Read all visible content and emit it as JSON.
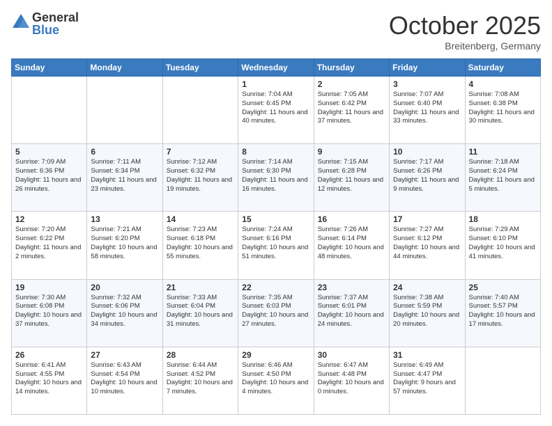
{
  "header": {
    "logo_general": "General",
    "logo_blue": "Blue",
    "month_title": "October 2025",
    "location": "Breitenberg, Germany"
  },
  "weekdays": [
    "Sunday",
    "Monday",
    "Tuesday",
    "Wednesday",
    "Thursday",
    "Friday",
    "Saturday"
  ],
  "weeks": [
    [
      {
        "day": "",
        "info": ""
      },
      {
        "day": "",
        "info": ""
      },
      {
        "day": "",
        "info": ""
      },
      {
        "day": "1",
        "info": "Sunrise: 7:04 AM\nSunset: 6:45 PM\nDaylight: 11 hours and 40 minutes."
      },
      {
        "day": "2",
        "info": "Sunrise: 7:05 AM\nSunset: 6:42 PM\nDaylight: 11 hours and 37 minutes."
      },
      {
        "day": "3",
        "info": "Sunrise: 7:07 AM\nSunset: 6:40 PM\nDaylight: 11 hours and 33 minutes."
      },
      {
        "day": "4",
        "info": "Sunrise: 7:08 AM\nSunset: 6:38 PM\nDaylight: 11 hours and 30 minutes."
      }
    ],
    [
      {
        "day": "5",
        "info": "Sunrise: 7:09 AM\nSunset: 6:36 PM\nDaylight: 11 hours and 26 minutes."
      },
      {
        "day": "6",
        "info": "Sunrise: 7:11 AM\nSunset: 6:34 PM\nDaylight: 11 hours and 23 minutes."
      },
      {
        "day": "7",
        "info": "Sunrise: 7:12 AM\nSunset: 6:32 PM\nDaylight: 11 hours and 19 minutes."
      },
      {
        "day": "8",
        "info": "Sunrise: 7:14 AM\nSunset: 6:30 PM\nDaylight: 11 hours and 16 minutes."
      },
      {
        "day": "9",
        "info": "Sunrise: 7:15 AM\nSunset: 6:28 PM\nDaylight: 11 hours and 12 minutes."
      },
      {
        "day": "10",
        "info": "Sunrise: 7:17 AM\nSunset: 6:26 PM\nDaylight: 11 hours and 9 minutes."
      },
      {
        "day": "11",
        "info": "Sunrise: 7:18 AM\nSunset: 6:24 PM\nDaylight: 11 hours and 5 minutes."
      }
    ],
    [
      {
        "day": "12",
        "info": "Sunrise: 7:20 AM\nSunset: 6:22 PM\nDaylight: 11 hours and 2 minutes."
      },
      {
        "day": "13",
        "info": "Sunrise: 7:21 AM\nSunset: 6:20 PM\nDaylight: 10 hours and 58 minutes."
      },
      {
        "day": "14",
        "info": "Sunrise: 7:23 AM\nSunset: 6:18 PM\nDaylight: 10 hours and 55 minutes."
      },
      {
        "day": "15",
        "info": "Sunrise: 7:24 AM\nSunset: 6:16 PM\nDaylight: 10 hours and 51 minutes."
      },
      {
        "day": "16",
        "info": "Sunrise: 7:26 AM\nSunset: 6:14 PM\nDaylight: 10 hours and 48 minutes."
      },
      {
        "day": "17",
        "info": "Sunrise: 7:27 AM\nSunset: 6:12 PM\nDaylight: 10 hours and 44 minutes."
      },
      {
        "day": "18",
        "info": "Sunrise: 7:29 AM\nSunset: 6:10 PM\nDaylight: 10 hours and 41 minutes."
      }
    ],
    [
      {
        "day": "19",
        "info": "Sunrise: 7:30 AM\nSunset: 6:08 PM\nDaylight: 10 hours and 37 minutes."
      },
      {
        "day": "20",
        "info": "Sunrise: 7:32 AM\nSunset: 6:06 PM\nDaylight: 10 hours and 34 minutes."
      },
      {
        "day": "21",
        "info": "Sunrise: 7:33 AM\nSunset: 6:04 PM\nDaylight: 10 hours and 31 minutes."
      },
      {
        "day": "22",
        "info": "Sunrise: 7:35 AM\nSunset: 6:03 PM\nDaylight: 10 hours and 27 minutes."
      },
      {
        "day": "23",
        "info": "Sunrise: 7:37 AM\nSunset: 6:01 PM\nDaylight: 10 hours and 24 minutes."
      },
      {
        "day": "24",
        "info": "Sunrise: 7:38 AM\nSunset: 5:59 PM\nDaylight: 10 hours and 20 minutes."
      },
      {
        "day": "25",
        "info": "Sunrise: 7:40 AM\nSunset: 5:57 PM\nDaylight: 10 hours and 17 minutes."
      }
    ],
    [
      {
        "day": "26",
        "info": "Sunrise: 6:41 AM\nSunset: 4:55 PM\nDaylight: 10 hours and 14 minutes."
      },
      {
        "day": "27",
        "info": "Sunrise: 6:43 AM\nSunset: 4:54 PM\nDaylight: 10 hours and 10 minutes."
      },
      {
        "day": "28",
        "info": "Sunrise: 6:44 AM\nSunset: 4:52 PM\nDaylight: 10 hours and 7 minutes."
      },
      {
        "day": "29",
        "info": "Sunrise: 6:46 AM\nSunset: 4:50 PM\nDaylight: 10 hours and 4 minutes."
      },
      {
        "day": "30",
        "info": "Sunrise: 6:47 AM\nSunset: 4:48 PM\nDaylight: 10 hours and 0 minutes."
      },
      {
        "day": "31",
        "info": "Sunrise: 6:49 AM\nSunset: 4:47 PM\nDaylight: 9 hours and 57 minutes."
      },
      {
        "day": "",
        "info": ""
      }
    ]
  ]
}
